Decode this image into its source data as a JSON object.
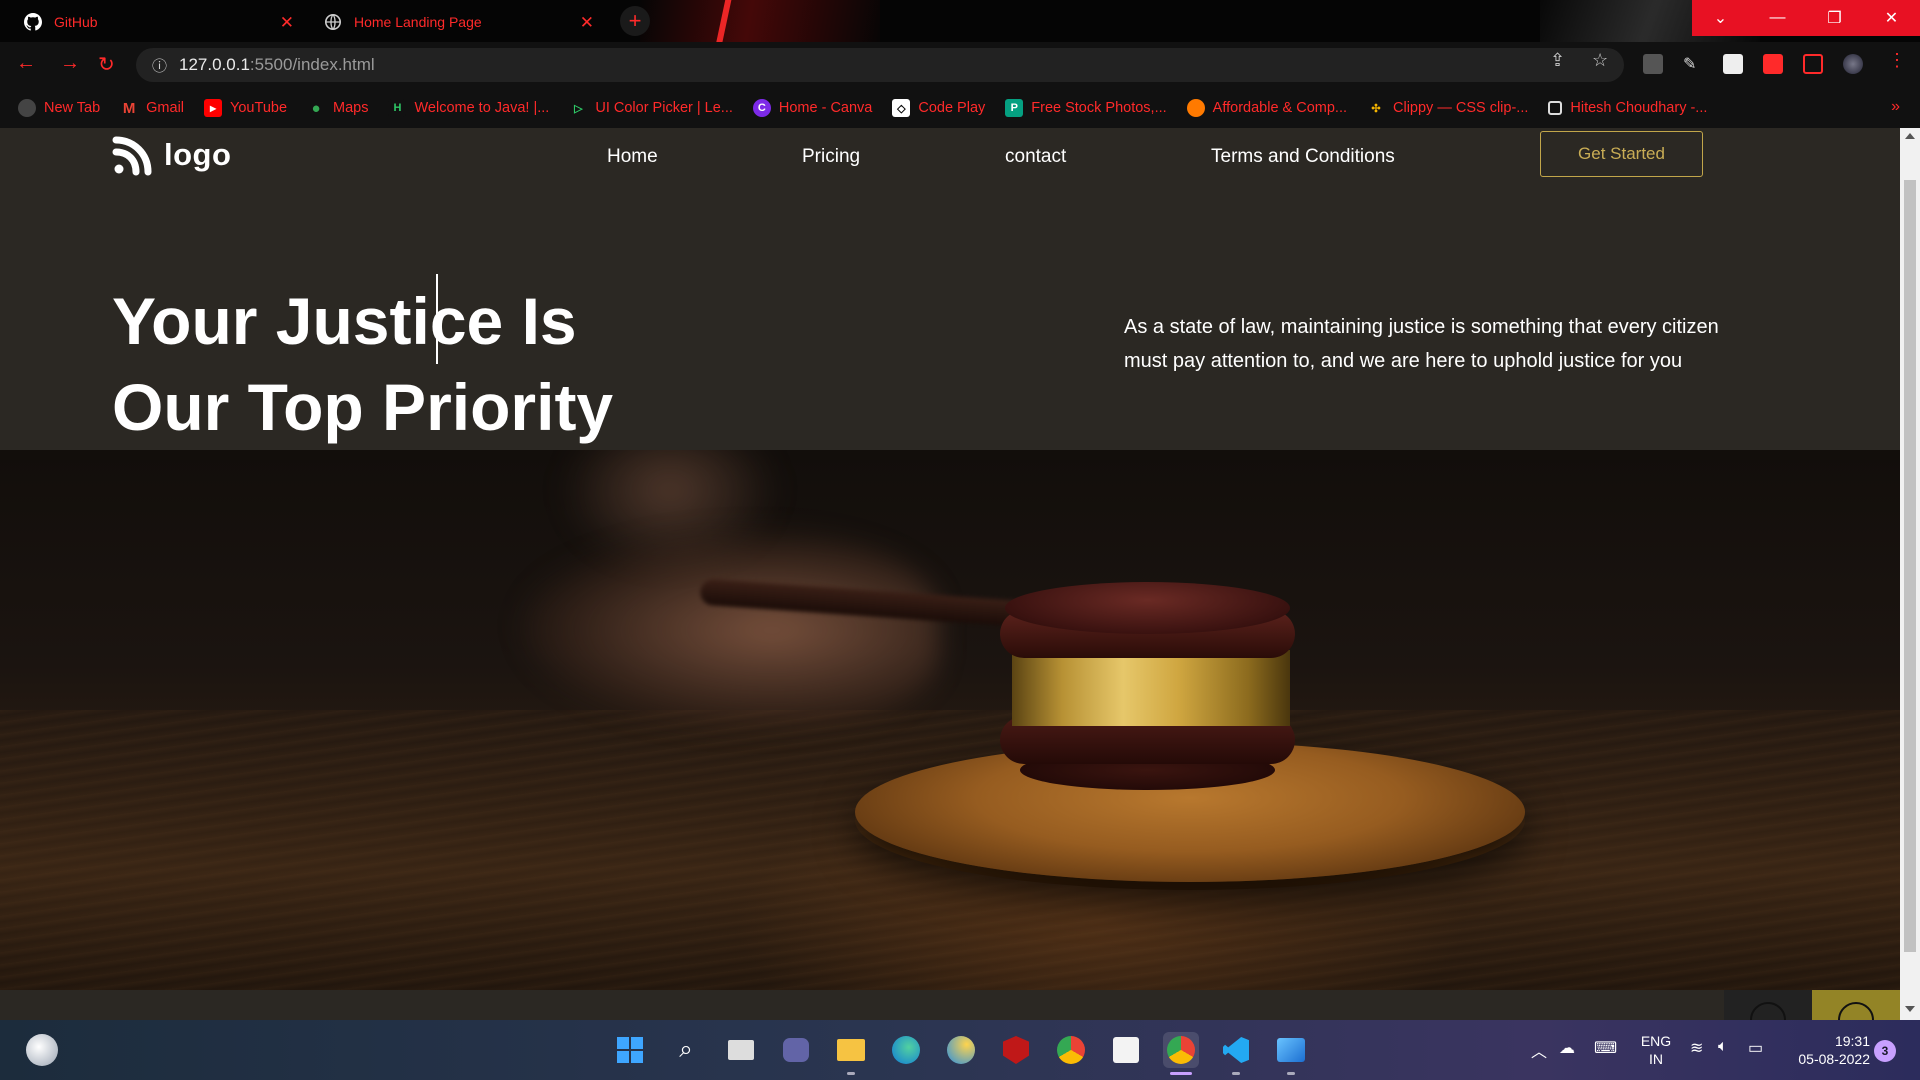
{
  "browser": {
    "tabs": [
      {
        "title": "GitHub",
        "icon": "github-icon"
      },
      {
        "title": "Home Landing Page",
        "icon": "globe-icon"
      }
    ],
    "new_tab_label": "+",
    "address": {
      "host": "127.0.0.1",
      "path": ":5500/index.html"
    },
    "bookmarks": [
      {
        "label": "New Tab",
        "icon": "globe-icon"
      },
      {
        "label": "Gmail",
        "icon": "gmail-icon"
      },
      {
        "label": "YouTube",
        "icon": "youtube-icon"
      },
      {
        "label": "Maps",
        "icon": "maps-icon"
      },
      {
        "label": "Welcome to Java! |...",
        "icon": "hackerrank-icon"
      },
      {
        "label": "UI Color Picker | Le...",
        "icon": "color-picker-icon"
      },
      {
        "label": "Home - Canva",
        "icon": "canva-icon"
      },
      {
        "label": "Code Play",
        "icon": "codepen-icon"
      },
      {
        "label": "Free Stock Photos,...",
        "icon": "pexels-icon"
      },
      {
        "label": "Affordable & Comp...",
        "icon": "hosting-icon"
      },
      {
        "label": "Clippy — CSS clip-...",
        "icon": "clippy-icon"
      },
      {
        "label": "Hitesh Choudhary -...",
        "icon": "page-icon"
      }
    ],
    "accent_color": "#ff2a2a"
  },
  "site": {
    "logo_text": "logo",
    "nav": [
      "Home",
      "Pricing",
      "contact",
      "Terms and Conditions"
    ],
    "cta_label": "Get Started",
    "hero_title_line1": "Your Justice Is",
    "hero_title_line2": "Our Top Priority",
    "hero_description": "As a state of law, maintaining justice is something that every citizen must pay attention to, and we are here to uphold justice for you",
    "background_color": "#2b2823",
    "accent_gold": "#c2a64a"
  },
  "taskbar": {
    "language_line1": "ENG",
    "language_line2": "IN",
    "time": "19:31",
    "date": "05-08-2022",
    "notification_count": "3"
  }
}
